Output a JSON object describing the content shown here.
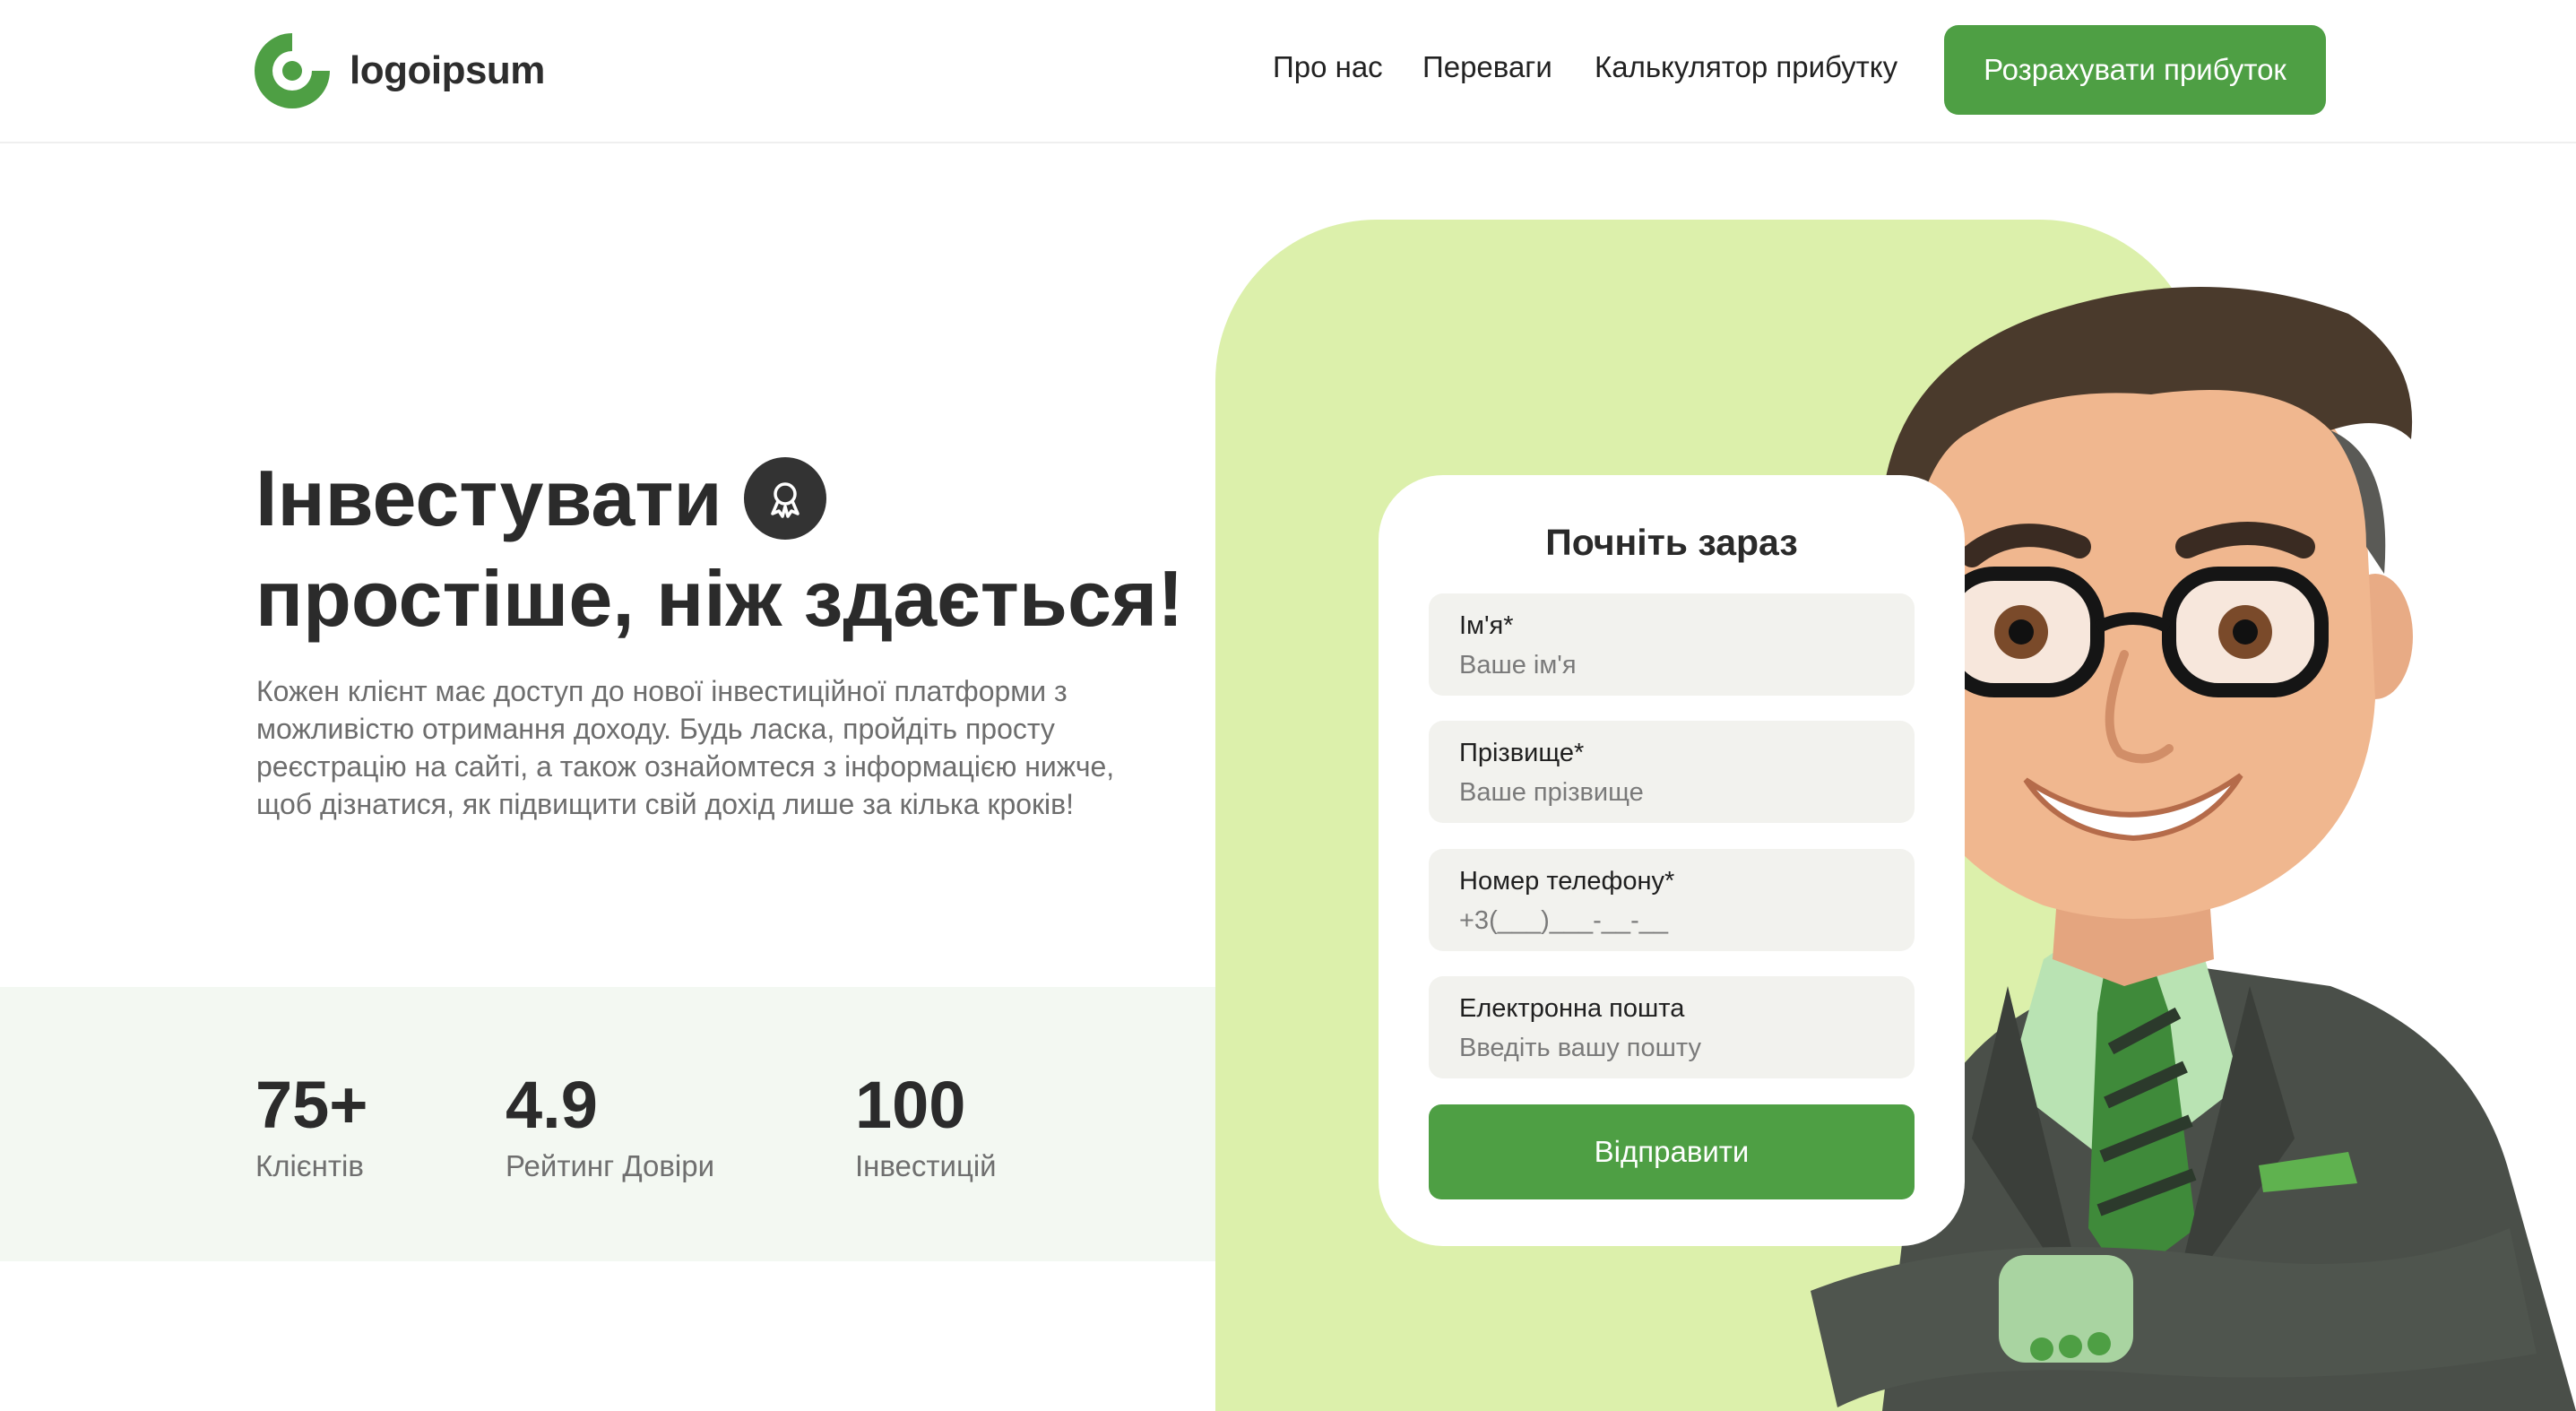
{
  "header": {
    "logo_text": "logoipsum",
    "nav": [
      "Про нас",
      "Переваги",
      "Калькулятор прибутку"
    ],
    "cta_label": "Розрахувати прибуток"
  },
  "hero": {
    "title_line1": "Інвестувати",
    "title_line2": "простіше, ніж здається!",
    "badge_icon": "award-icon",
    "description": "Кожен клієнт має доступ до нової інвестиційної платформи з можливістю отримання доходу. Будь ласка, пройдіть просту реєстрацію на сайті, а також ознайомтеся з інформацією нижче, щоб дізнатися, як підвищити свій дохід лише за кілька кроків!"
  },
  "stats": [
    {
      "value": "75+",
      "label": "Клієнтів"
    },
    {
      "value": "4.9",
      "label": "Рейтинг Довіри"
    },
    {
      "value": "100",
      "label": "Інвестицій"
    }
  ],
  "form": {
    "title": "Почніть зараз",
    "fields": [
      {
        "label": "Ім'я*",
        "placeholder": "Ваше ім'я"
      },
      {
        "label": "Прізвище*",
        "placeholder": "Ваше прізвище"
      },
      {
        "label": "Номер телефону*",
        "placeholder": "+3(___)___-__-__"
      },
      {
        "label": "Електронна пошта",
        "placeholder": "Введіть вашу пошту"
      }
    ],
    "submit_label": "Відправити"
  },
  "colors": {
    "brand_green": "#4e9f44",
    "panel_green": "#dcf0ab",
    "stats_bg": "#f3f8f2"
  }
}
